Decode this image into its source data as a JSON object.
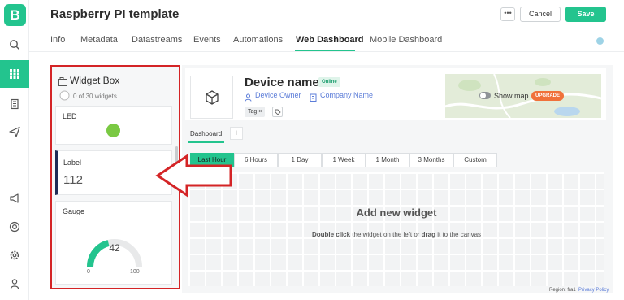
{
  "app": {
    "logo_letter": "B",
    "brand_color": "#23c48e",
    "accent_red": "#d42426"
  },
  "rail": [
    {
      "icon": "search-icon",
      "active": false
    },
    {
      "icon": "grid-icon",
      "active": true
    },
    {
      "icon": "building-icon",
      "active": false
    },
    {
      "icon": "send-icon",
      "active": false
    },
    {
      "icon": "megaphone-icon",
      "active": false
    },
    {
      "icon": "lifebuoy-icon",
      "active": false
    },
    {
      "icon": "gear-icon",
      "active": false
    },
    {
      "icon": "user-icon",
      "active": false
    }
  ],
  "header": {
    "title": "Raspberry PI template",
    "more_label": "•••",
    "cancel_label": "Cancel",
    "save_label": "Save"
  },
  "tabs": [
    "Info",
    "Metadata",
    "Datastreams",
    "Events",
    "Automations",
    "Web Dashboard",
    "Mobile Dashboard"
  ],
  "active_tab": "Web Dashboard",
  "widget_box": {
    "title": "Widget Box",
    "count": "0 of 30 widgets",
    "led": {
      "label": "LED",
      "color": "#7ac943"
    },
    "label_widget": {
      "label": "Label",
      "value": "112"
    },
    "gauge": {
      "label": "Gauge",
      "value": "42",
      "min": "0",
      "max": "100",
      "fill_fraction": 0.42
    }
  },
  "device": {
    "name": "Device name",
    "status": "Online",
    "owner_link": "Device Owner",
    "company_link": "Company Name",
    "tag": "Tag ×",
    "show_map": "Show map",
    "upgrade": "UPGRADE"
  },
  "dashboard": {
    "tab": "Dashboard",
    "add_tab": "+",
    "ranges": [
      "Last Hour",
      "6 Hours",
      "1 Day",
      "1 Week",
      "1 Month",
      "3 Months",
      "Custom"
    ],
    "add_title": "Add new widget",
    "add_desc_1": "Double click",
    "add_desc_2": " the widget on the left or ",
    "add_desc_3": "drag",
    "add_desc_4": " it to the canvas"
  },
  "footer": {
    "region": "Region: fra1",
    "privacy": "Privacy Policy"
  }
}
